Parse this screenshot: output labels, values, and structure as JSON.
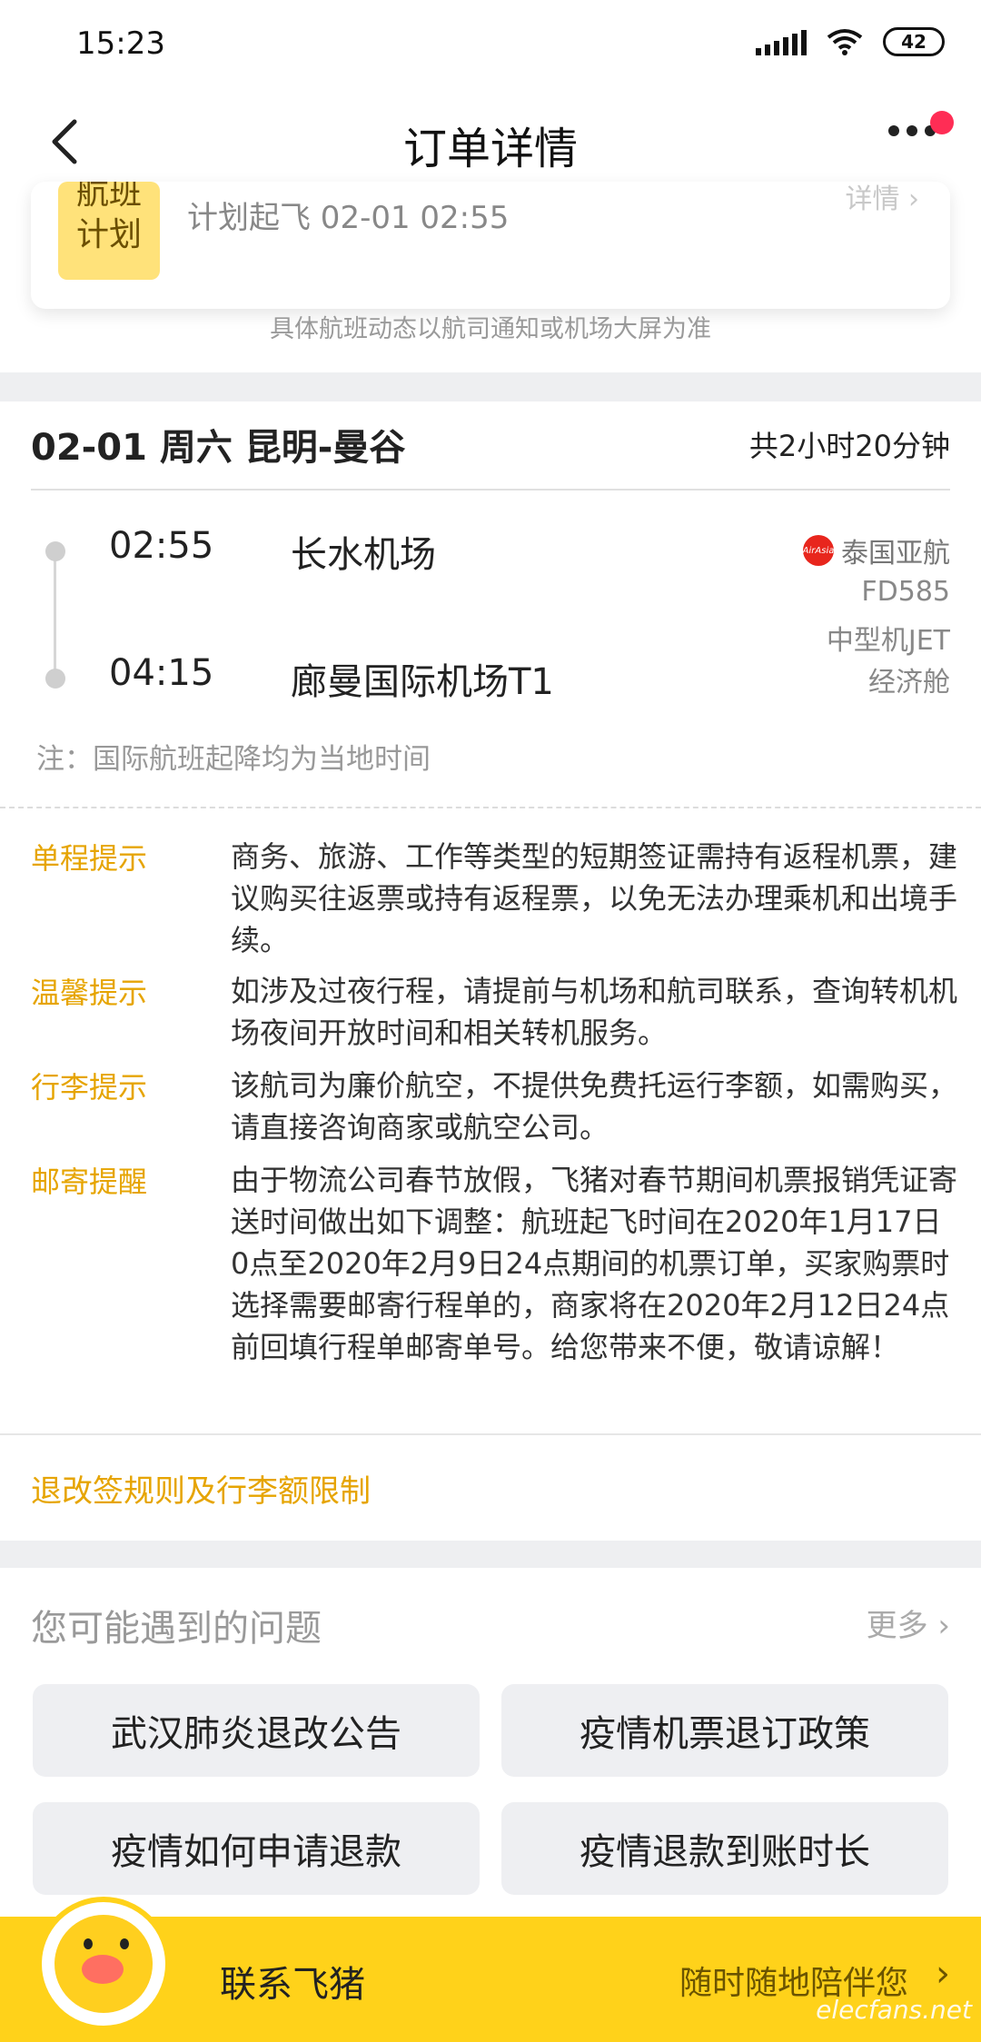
{
  "status_bar": {
    "time": "15:23",
    "battery": "42"
  },
  "nav": {
    "title": "订单详情"
  },
  "flight_status": {
    "badge": "航班计划",
    "badge_top": "航班",
    "badge_bottom": "计划",
    "subtitle": "计划起飞 02-01 02:55",
    "detail_label": "详情",
    "disclaimer": "具体航班动态以航司通知或机场大屏为准"
  },
  "route": {
    "header": "02-01 周六 昆明-曼谷",
    "duration": "共2小时20分钟",
    "departure_time": "02:55",
    "departure_airport": "长水机场",
    "arrival_time": "04:15",
    "arrival_airport": "廊曼国际机场T1",
    "airline": "泰国亚航",
    "airline_logo_text": "AirAsia",
    "flight_no": "FD585",
    "aircraft": "中型机JET",
    "cabin": "经济舱",
    "note": "注：国际航班起降均为当地时间"
  },
  "tips": [
    {
      "label": "单程提示",
      "text": "商务、旅游、工作等类型的短期签证需持有返程机票，建议购买往返票或持有返程票，以免无法办理乘机和出境手续。"
    },
    {
      "label": "温馨提示",
      "text": "如涉及过夜行程，请提前与机场和航司联系，查询转机机场夜间开放时间和相关转机服务。"
    },
    {
      "label": "行李提示",
      "text": "该航司为廉价航空，不提供免费托运行李额，如需购买，请直接咨询商家或航空公司。"
    },
    {
      "label": "邮寄提醒",
      "text": "由于物流公司春节放假，飞猪对春节期间机票报销凭证寄送时间做出如下调整：航班起飞时间在2020年1月17日0点至2020年2月9日24点期间的机票订单，买家购票时选择需要邮寄行程单的，商家将在2020年2月12日24点前回填行程单邮寄单号。给您带来不便，敬请谅解！"
    }
  ],
  "rules_link": "退改签规则及行李额限制",
  "faq": {
    "title": "您可能遇到的问题",
    "more": "更多",
    "items": [
      "武汉肺炎退改公告",
      "疫情机票退订政策",
      "疫情如何申请退款",
      "疫情退款到账时长"
    ]
  },
  "bottom_bar": {
    "contact": "联系飞猪",
    "slogan": "随时随地陪伴您",
    "watermark": "elecfans.net"
  },
  "colors": {
    "accent": "#e6a400",
    "bottom_bar": "#ffd21a",
    "badge": "#ffe27a",
    "red_dot": "#ff2d55"
  }
}
